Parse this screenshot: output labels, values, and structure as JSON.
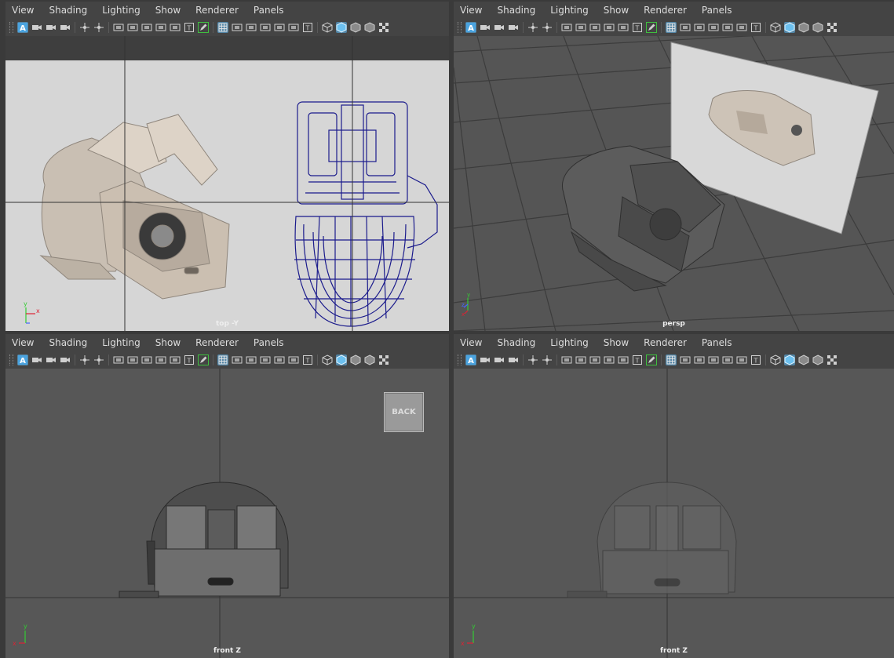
{
  "menus": [
    "View",
    "Shading",
    "Lighting",
    "Show",
    "Renderer",
    "Panels"
  ],
  "panels": [
    {
      "label": "top -Y"
    },
    {
      "label": "persp"
    },
    {
      "label": "front Z",
      "button": "BACK"
    },
    {
      "label": "front Z"
    }
  ],
  "colors": {
    "accent": "#5285a6",
    "wire": "#1b1b8c",
    "axis_x": "#d23",
    "axis_y": "#3c3",
    "axis_z": "#46f"
  }
}
